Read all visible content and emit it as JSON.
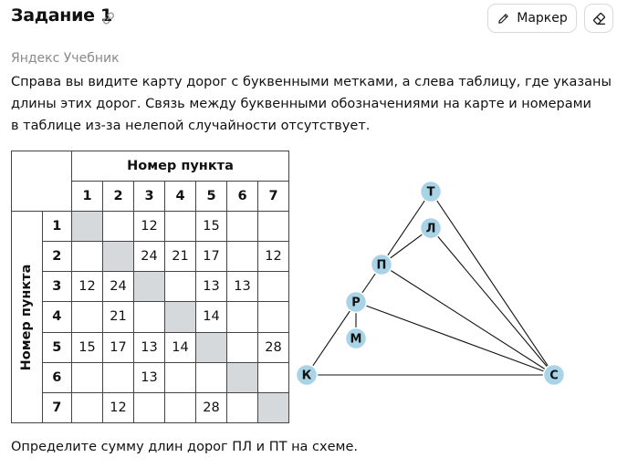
{
  "header": {
    "title": "Задание 1",
    "marker_label": "Маркер"
  },
  "source": "Яндекс Учебник",
  "paragraph": [
    "Справа вы видите карту дорог с буквенными метками, а слева таблицу, где указаны",
    "длины этих дорог. Связь между буквенными обозначениями на карте и номерами",
    "в таблице из-за нелепой случайности отсутствует."
  ],
  "table": {
    "col_header": "Номер пункта",
    "row_header": "Номер пункта",
    "columns": [
      "1",
      "2",
      "3",
      "4",
      "5",
      "6",
      "7"
    ],
    "rows": [
      {
        "label": "1",
        "cells": [
          "",
          "",
          "12",
          "",
          "15",
          "",
          ""
        ]
      },
      {
        "label": "2",
        "cells": [
          "",
          "",
          "24",
          "21",
          "17",
          "",
          "12"
        ]
      },
      {
        "label": "3",
        "cells": [
          "12",
          "24",
          "",
          "",
          "13",
          "13",
          ""
        ]
      },
      {
        "label": "4",
        "cells": [
          "",
          "21",
          "",
          "",
          "14",
          "",
          ""
        ]
      },
      {
        "label": "5",
        "cells": [
          "15",
          "17",
          "13",
          "14",
          "",
          "",
          "28"
        ]
      },
      {
        "label": "6",
        "cells": [
          "",
          "",
          "13",
          "",
          "",
          "",
          ""
        ]
      },
      {
        "label": "7",
        "cells": [
          "",
          "12",
          "",
          "",
          "28",
          "",
          ""
        ]
      }
    ]
  },
  "graph": {
    "nodes": [
      {
        "id": "T",
        "label": "Т"
      },
      {
        "id": "L",
        "label": "Л"
      },
      {
        "id": "P",
        "label": "П"
      },
      {
        "id": "R",
        "label": "Р"
      },
      {
        "id": "M",
        "label": "М"
      },
      {
        "id": "K",
        "label": "К"
      },
      {
        "id": "C",
        "label": "С"
      }
    ],
    "edges": [
      [
        "T",
        "P"
      ],
      [
        "T",
        "C"
      ],
      [
        "L",
        "P"
      ],
      [
        "L",
        "C"
      ],
      [
        "P",
        "R"
      ],
      [
        "P",
        "C"
      ],
      [
        "R",
        "M"
      ],
      [
        "R",
        "K"
      ],
      [
        "R",
        "C"
      ],
      [
        "K",
        "C"
      ]
    ],
    "node_color": "#a9d3e6",
    "node_stroke": "#ffffff"
  },
  "question": "Определите сумму длин дорог ПЛ и ПТ на схеме."
}
